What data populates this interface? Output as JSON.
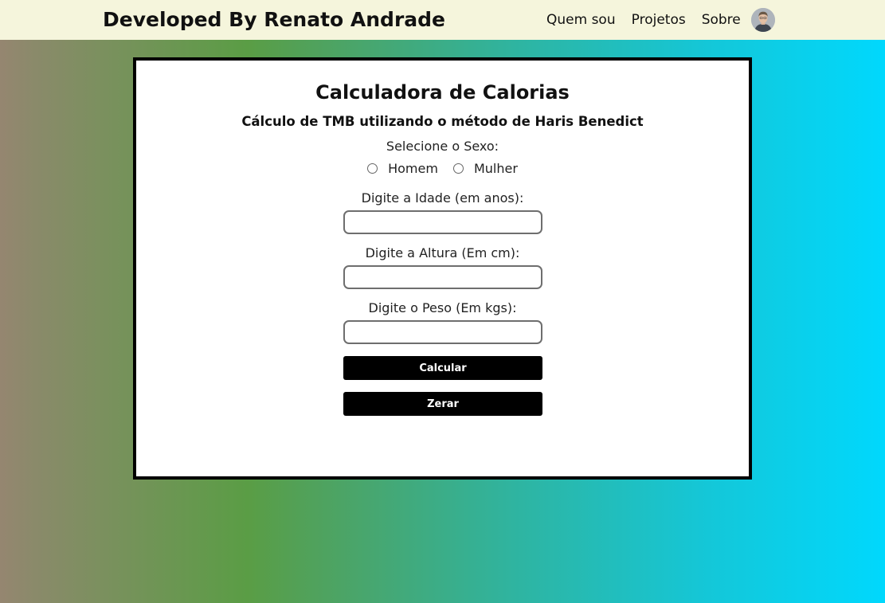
{
  "navbar": {
    "brand": "Developed By Renato Andrade",
    "links": [
      "Quem sou",
      "Projetos",
      "Sobre"
    ],
    "avatar_icon": "user-avatar-photo"
  },
  "card": {
    "title": "Calculadora de Calorias",
    "subtitle": "Cálculo de TMB utilizando o método de Haris Benedict",
    "sex_label": "Selecione o Sexo:",
    "sex_options": [
      "Homem",
      "Mulher"
    ],
    "age_label": "Digite a Idade (em anos):",
    "age_value": "",
    "height_label": "Digite a Altura (Em cm):",
    "height_value": "",
    "weight_label": "Digite o Peso (Em kgs):",
    "weight_value": "",
    "calc_button": "Calcular",
    "reset_button": "Zerar"
  },
  "colors": {
    "navbar_bg": "#f5f5dc",
    "button_bg": "#000000",
    "gradient_left": "#958670",
    "gradient_mid": "#5a9d45",
    "gradient_right": "#00d8fd"
  }
}
